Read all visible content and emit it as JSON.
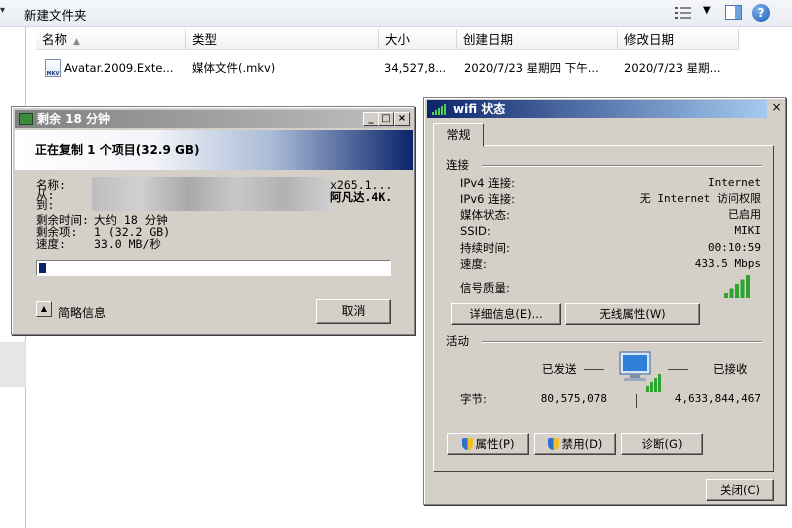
{
  "explorer": {
    "new_folder": "新建文件夹",
    "columns": {
      "name": "名称",
      "type": "类型",
      "size": "大小",
      "created": "创建日期",
      "modified": "修改日期"
    },
    "file": {
      "name": "Avatar.2009.Exte...",
      "icon_text": "MKV",
      "type": "媒体文件(.mkv)",
      "size": "34,527,8...",
      "created": "2020/7/23 星期四 下午...",
      "modified": "2020/7/23 星期..."
    }
  },
  "copy_dialog": {
    "title": "剩余 18 分钟",
    "banner": "正在复制 1 个项目(32.9 GB)",
    "name_label": "名称:",
    "name_value_fragment": "x265.1...",
    "from_label": "从:",
    "from_value_fragment": "阿凡达.4K.",
    "to_label": "到:",
    "time_left_label": "剩余时间:",
    "time_left_value": "大约 18 分钟",
    "items_left_label": "剩余项:",
    "items_left_value": "1 (32.2 GB)",
    "speed_label": "速度:",
    "speed_value": "33.0 MB/秒",
    "progress_fraction": 0.02,
    "details_label": "简略信息",
    "cancel_button": "取消",
    "title_buttons": [
      "_",
      "□",
      "×"
    ]
  },
  "wifi_dialog": {
    "title": "wifi 状态",
    "close": "×",
    "tab_general": "常规",
    "connection_section": "连接",
    "rows": [
      {
        "label": "IPv4 连接:",
        "value": "Internet"
      },
      {
        "label": "IPv6 连接:",
        "value": "无 Internet 访问权限"
      },
      {
        "label": "媒体状态:",
        "value": "已启用"
      },
      {
        "label": "SSID:",
        "value": "MIKI"
      },
      {
        "label": "持续时间:",
        "value": "00:10:59"
      },
      {
        "label": "速度:",
        "value": "433.5 Mbps"
      }
    ],
    "signal_label": "信号质量:",
    "signal_bars": 5,
    "details_button": "详细信息(E)...",
    "wireless_props_button": "无线属性(W)",
    "activity_section": "活动",
    "sent_label": "已发送",
    "received_label": "已接收",
    "bytes_label": "字节:",
    "bytes_sent": "80,575,078",
    "bytes_received": "4,633,844,467",
    "properties_button": "属性(P)",
    "disable_button": "禁用(D)",
    "diagnose_button": "诊断(G)",
    "close_button": "关闭(C)"
  },
  "colors": {
    "copy_banner_dark": "#0a246a",
    "wifi_title": "#0a246a",
    "signal_green": "#2fa32f"
  }
}
